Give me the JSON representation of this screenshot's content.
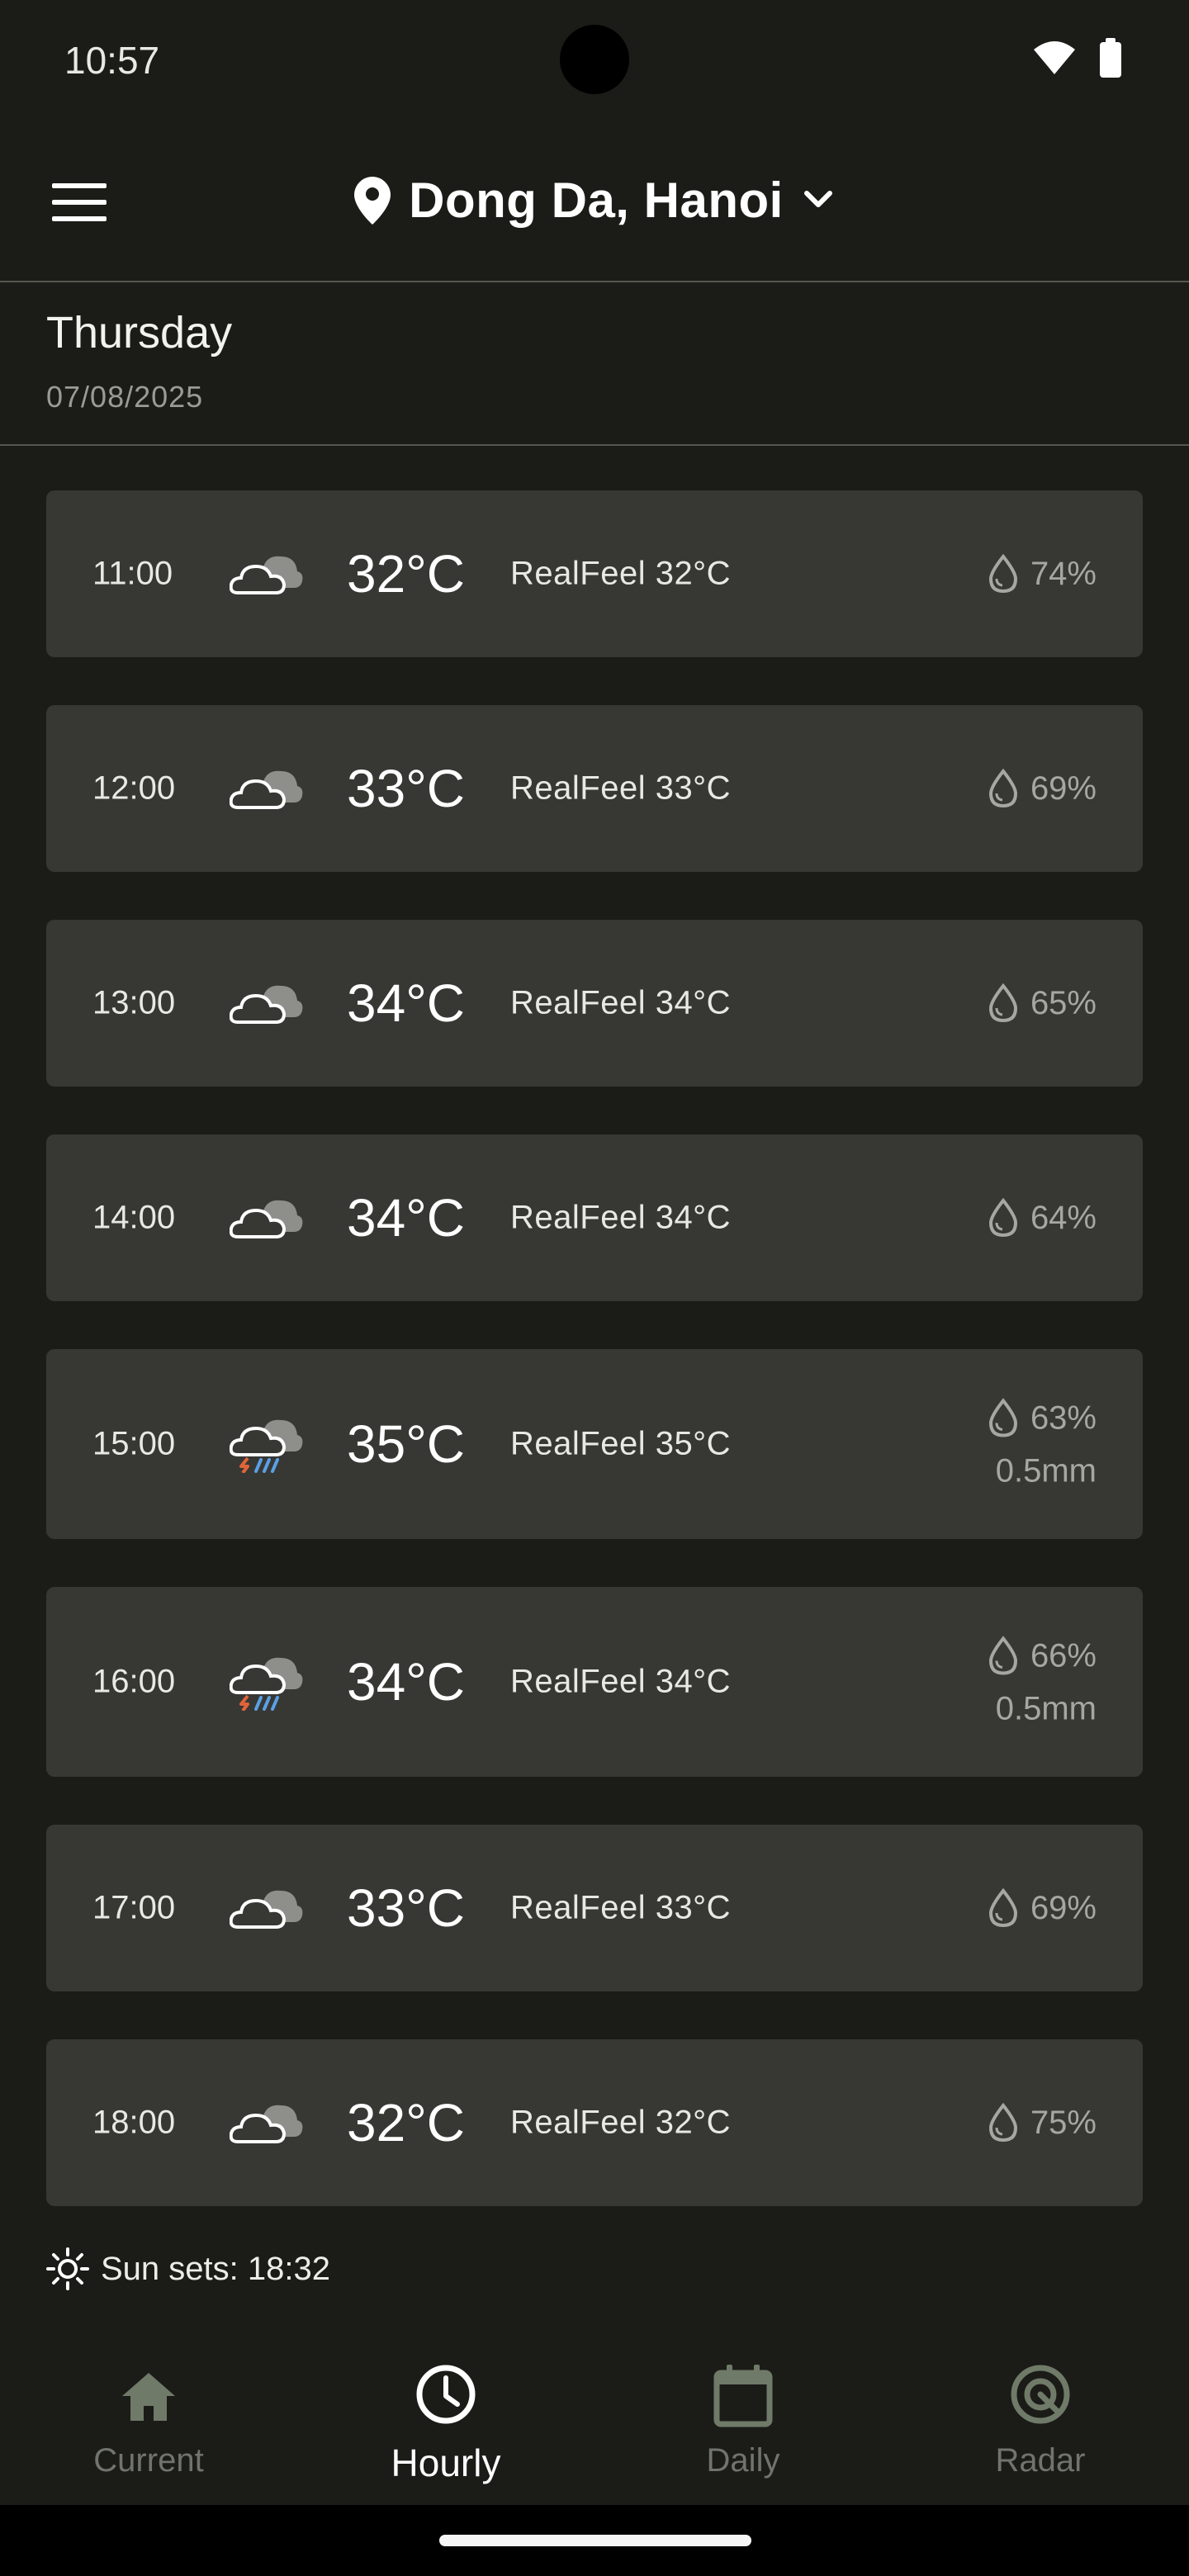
{
  "status_bar": {
    "time": "10:57"
  },
  "header": {
    "location": "Dong Da, Hanoi"
  },
  "day": {
    "name": "Thursday",
    "date": "07/08/2025"
  },
  "hours": [
    {
      "time": "11:00",
      "icon": "cloudy-icon",
      "temp": "32°C",
      "realfeel": "RealFeel 32°C",
      "humidity": "74%",
      "precip": ""
    },
    {
      "time": "12:00",
      "icon": "cloudy-icon",
      "temp": "33°C",
      "realfeel": "RealFeel 33°C",
      "humidity": "69%",
      "precip": ""
    },
    {
      "time": "13:00",
      "icon": "cloudy-icon",
      "temp": "34°C",
      "realfeel": "RealFeel 34°C",
      "humidity": "65%",
      "precip": ""
    },
    {
      "time": "14:00",
      "icon": "cloudy-icon",
      "temp": "34°C",
      "realfeel": "RealFeel 34°C",
      "humidity": "64%",
      "precip": ""
    },
    {
      "time": "15:00",
      "icon": "thunderstorm-rain-icon",
      "temp": "35°C",
      "realfeel": "RealFeel 35°C",
      "humidity": "63%",
      "precip": "0.5mm"
    },
    {
      "time": "16:00",
      "icon": "thunderstorm-rain-icon",
      "temp": "34°C",
      "realfeel": "RealFeel 34°C",
      "humidity": "66%",
      "precip": "0.5mm"
    },
    {
      "time": "17:00",
      "icon": "cloudy-icon",
      "temp": "33°C",
      "realfeel": "RealFeel 33°C",
      "humidity": "69%",
      "precip": ""
    },
    {
      "time": "18:00",
      "icon": "cloudy-icon",
      "temp": "32°C",
      "realfeel": "RealFeel 32°C",
      "humidity": "75%",
      "precip": ""
    }
  ],
  "sunset": {
    "text": "Sun sets: 18:32"
  },
  "nav": {
    "items": [
      {
        "label": "Current",
        "icon": "home-icon"
      },
      {
        "label": "Hourly",
        "icon": "clock-icon"
      },
      {
        "label": "Daily",
        "icon": "calendar-icon"
      },
      {
        "label": "Radar",
        "icon": "radar-icon"
      }
    ],
    "active": "Hourly"
  },
  "colors": {
    "background": "#1b1c18",
    "card": "#373834",
    "divider": "#55574f",
    "muted_text": "#a6a7a1",
    "inactive_nav": "#71736d",
    "nav_icon_inactive": "#6f7a68",
    "lightning": "#e0643a",
    "rain": "#5aa0e6"
  }
}
